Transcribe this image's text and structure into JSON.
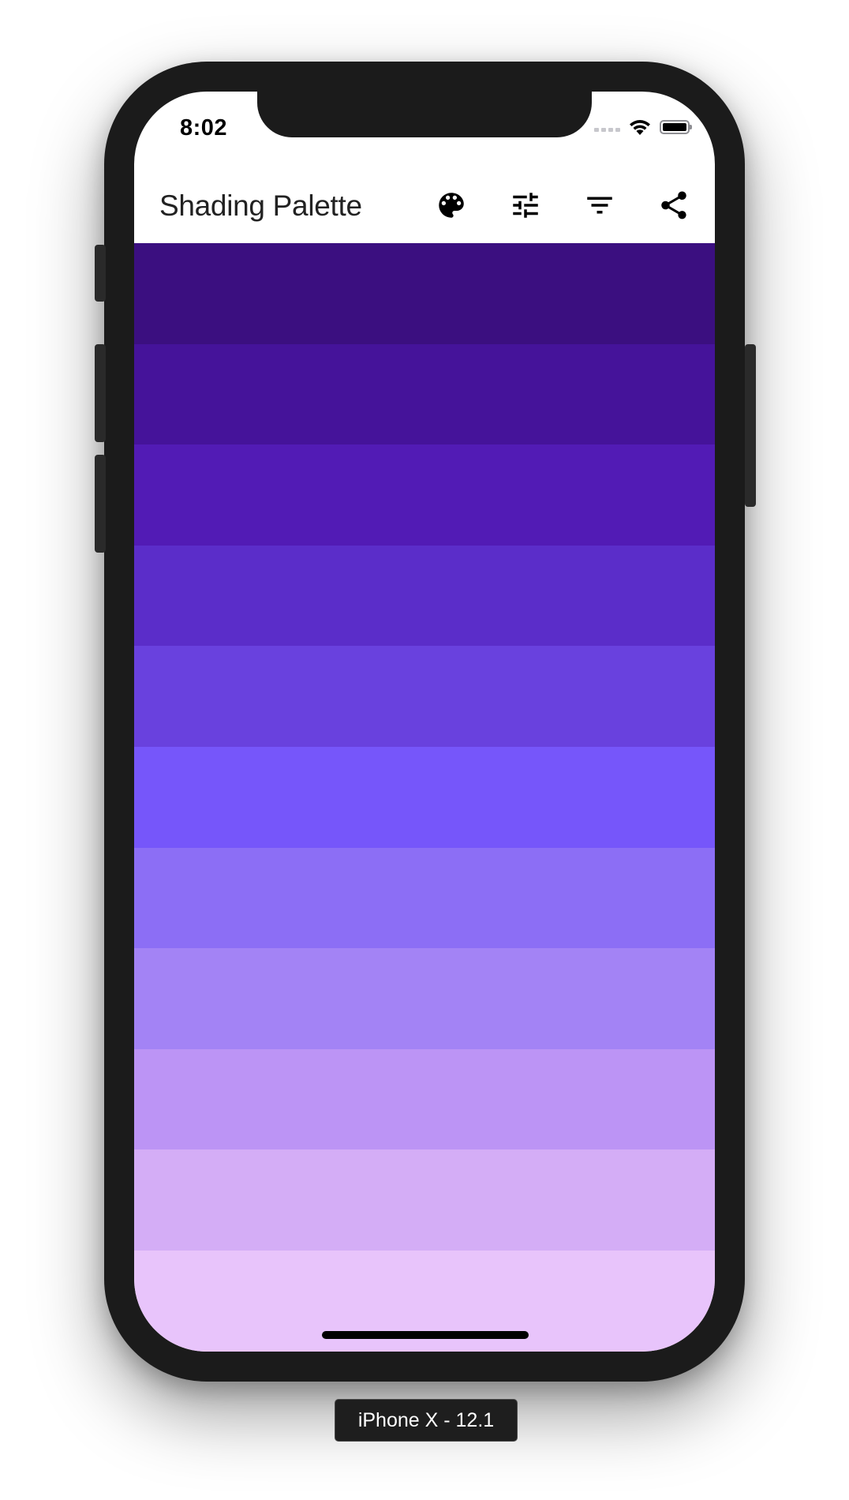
{
  "status_bar": {
    "time": "8:02"
  },
  "app_bar": {
    "title": "Shading Palette",
    "actions": [
      {
        "icon": "palette-icon"
      },
      {
        "icon": "tune-icon"
      },
      {
        "icon": "filter-icon"
      },
      {
        "icon": "share-icon"
      }
    ]
  },
  "shades": [
    "#3b0f80",
    "#45139a",
    "#521bb5",
    "#5b2dc9",
    "#6941de",
    "#7656fa",
    "#8c6ef5",
    "#a383f5",
    "#bc94f5",
    "#d4adf6",
    "#e8c4fb"
  ],
  "device_label": "iPhone X - 12.1"
}
